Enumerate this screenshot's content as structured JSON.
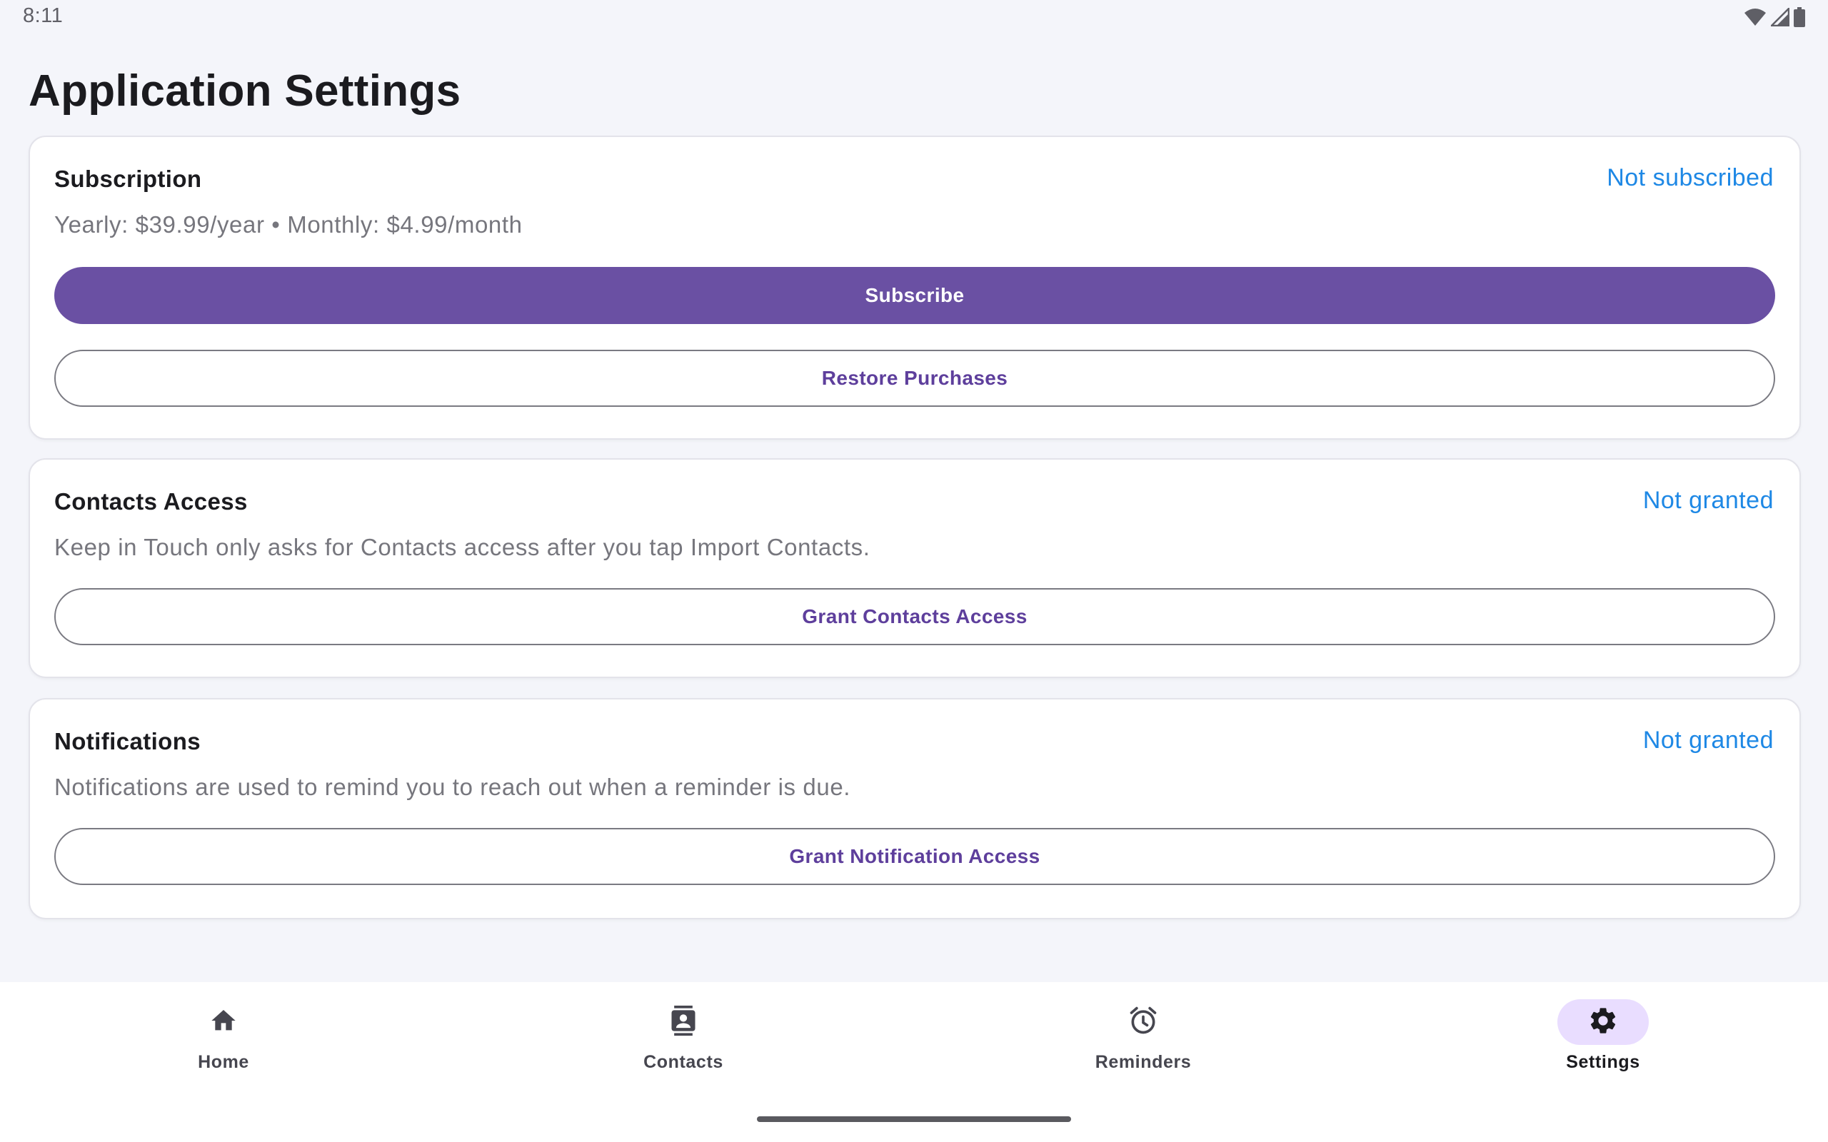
{
  "status_bar": {
    "time": "8:11",
    "icons": [
      "wifi-icon",
      "cell-signal-icon",
      "battery-icon"
    ]
  },
  "page": {
    "title": "Application Settings"
  },
  "subscription": {
    "title": "Subscription",
    "status": "Not subscribed",
    "description": "Yearly: $39.99/year • Monthly: $4.99/month",
    "subscribe_label": "Subscribe",
    "restore_label": "Restore Purchases"
  },
  "contacts_access": {
    "title": "Contacts Access",
    "status": "Not granted",
    "description": "Keep in Touch only asks for Contacts access after you tap Import Contacts.",
    "button_label": "Grant Contacts Access"
  },
  "notifications": {
    "title": "Notifications",
    "status": "Not granted",
    "description": "Notifications are used to remind you to reach out when a reminder is due.",
    "button_label": "Grant Notification Access"
  },
  "bottom_nav": {
    "items": [
      {
        "label": "Home",
        "icon": "home-icon",
        "active": false
      },
      {
        "label": "Contacts",
        "icon": "contacts-icon",
        "active": false
      },
      {
        "label": "Reminders",
        "icon": "alarm-icon",
        "active": false
      },
      {
        "label": "Settings",
        "icon": "gear-icon",
        "active": true
      }
    ]
  },
  "colors": {
    "primary": "#6a50a3",
    "status_link": "#1e88e5",
    "background": "#f4f5fa",
    "nav_active_pill": "#e9ddff"
  }
}
